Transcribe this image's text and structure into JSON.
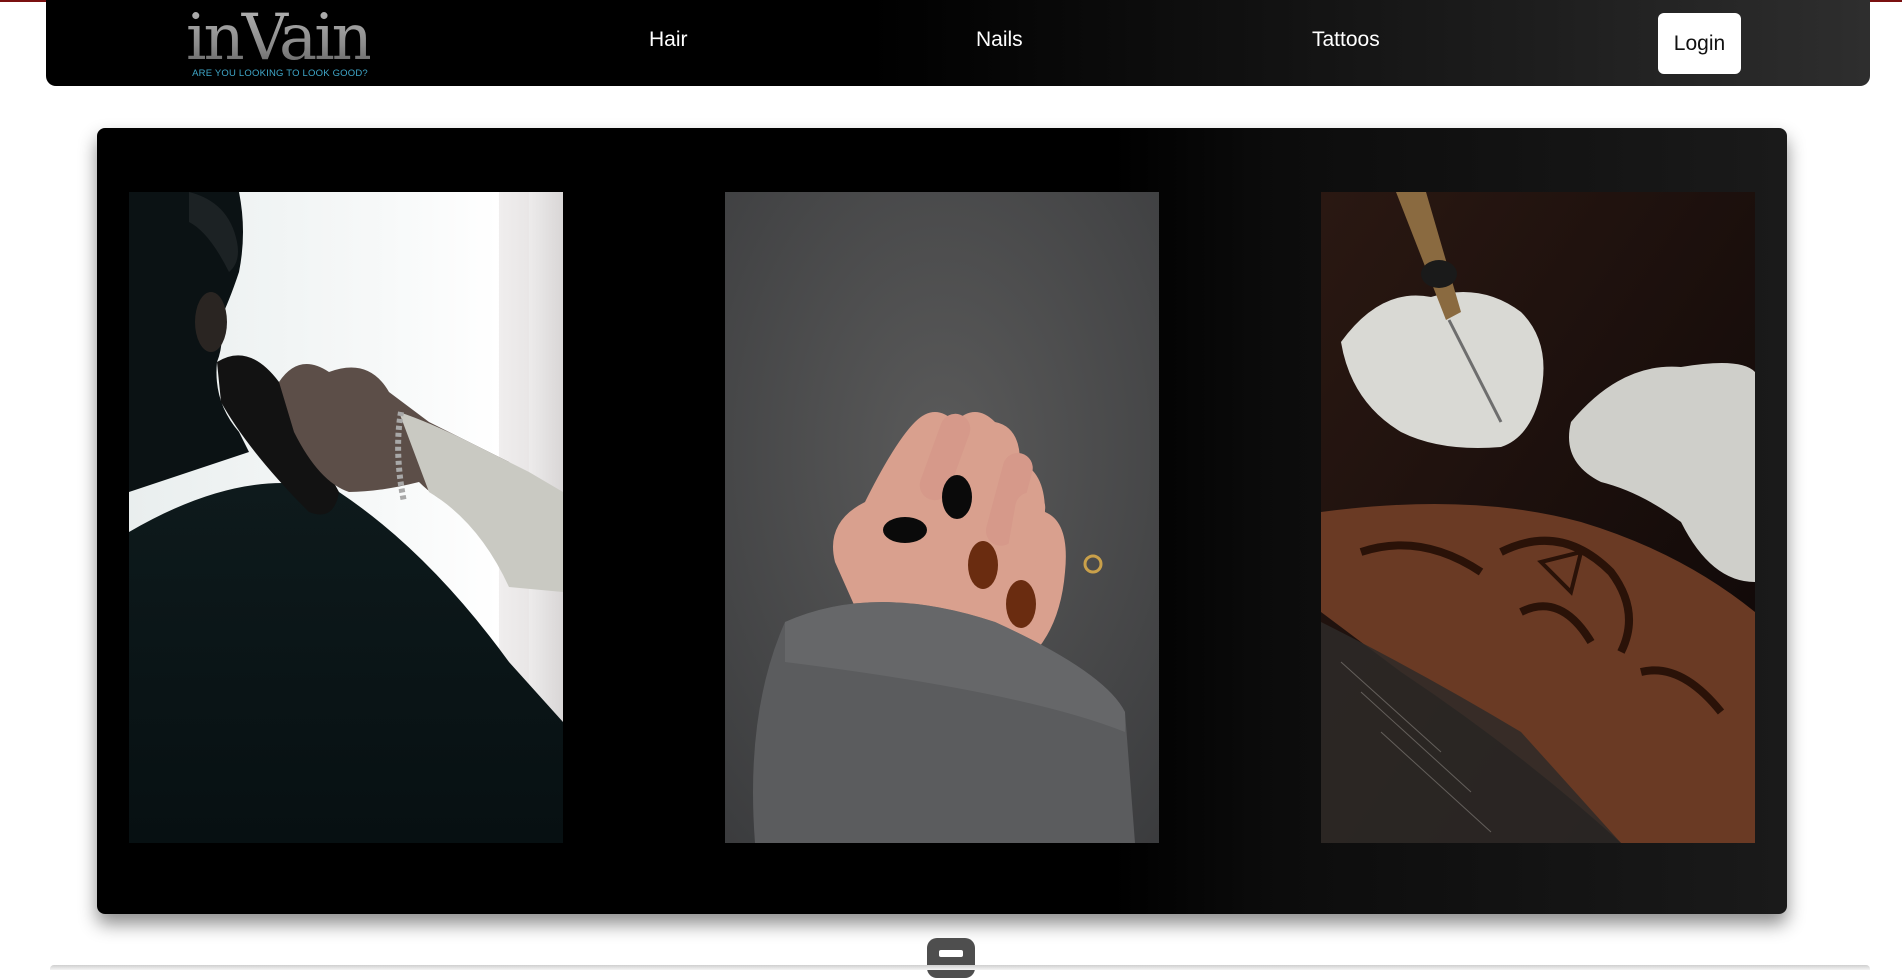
{
  "header": {
    "logo_text": "inVain",
    "logo_tagline": "ARE YOU LOOKING TO LOOK GOOD?",
    "nav": {
      "hair": "Hair",
      "nails": "Nails",
      "tattoos": "Tattoos"
    },
    "login_label": "Login"
  },
  "gallery": {
    "photos": [
      {
        "subject": "hair",
        "icon": "barber-clipper-photo"
      },
      {
        "subject": "nails",
        "icon": "manicure-hand-photo"
      },
      {
        "subject": "tattoos",
        "icon": "tattoo-artist-photo"
      }
    ]
  },
  "colors": {
    "nav_background": "#000000",
    "tagline": "#3fa7c9",
    "accent_line": "#7a1010",
    "scroll_handle": "#4e4e4e"
  }
}
